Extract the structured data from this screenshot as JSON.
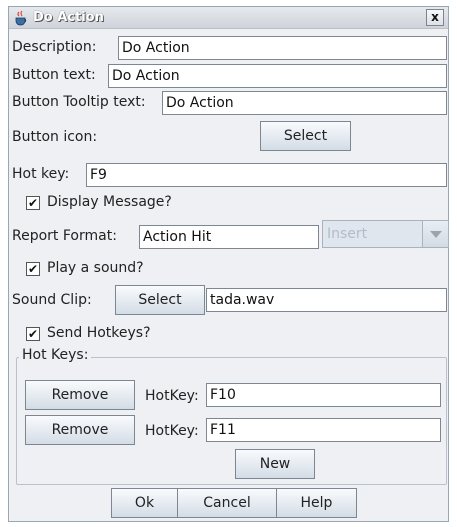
{
  "window": {
    "title": "Do Action",
    "close_glyph": "x"
  },
  "form": {
    "description_label": "Description:",
    "description_value": "Do Action",
    "button_text_label": "Button text:",
    "button_text_value": "Do Action",
    "button_tooltip_label": "Button Tooltip text:",
    "button_tooltip_value": "Do Action",
    "button_icon_label": "Button icon:",
    "icon_select_label": "Select",
    "hot_key_label": "Hot key:",
    "hot_key_value": "F9",
    "display_message_label": "Display Message?",
    "display_message_checked": true,
    "report_format_label": "Report Format:",
    "report_format_value": "Action Hit",
    "insert_combo_value": "Insert",
    "play_sound_label": "Play a sound?",
    "play_sound_checked": true,
    "sound_clip_label": "Sound Clip:",
    "sound_select_label": "Select",
    "sound_clip_value": "tada.wav",
    "send_hotkeys_label": "Send Hotkeys?",
    "send_hotkeys_checked": true
  },
  "hotkeys_group": {
    "title": "Hot Keys:",
    "rows": [
      {
        "remove_label": "Remove",
        "hotkey_label": "HotKey:",
        "value": "F10"
      },
      {
        "remove_label": "Remove",
        "hotkey_label": "HotKey:",
        "value": "F11"
      }
    ],
    "new_label": "New"
  },
  "footer": {
    "ok_label": "Ok",
    "cancel_label": "Cancel",
    "help_label": "Help"
  },
  "check_glyph": "✔",
  "colors": {
    "window_bg": "#eef0f3",
    "title_gradient_top": "#e6e9ed",
    "button_gradient_bottom": "#d3dce6"
  },
  "icons": {
    "title_icon": "java-cup-icon",
    "checkbox": "checkmark-icon",
    "combo_arrow": "chevron-down-icon"
  }
}
